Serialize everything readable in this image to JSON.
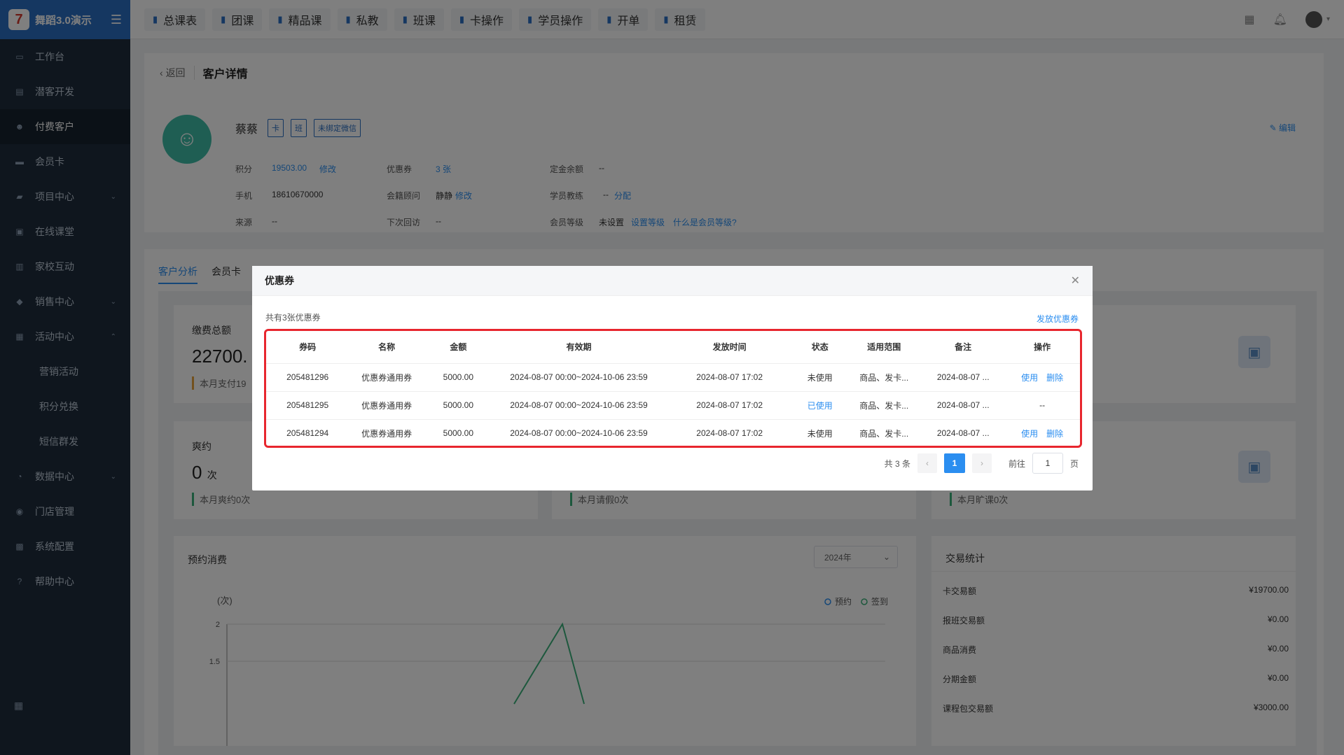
{
  "brand": {
    "title": "舞蹈3.0演示",
    "logo_glyph": "7"
  },
  "sidebar": {
    "items": [
      {
        "label": "工作台",
        "icon": "monitor-icon"
      },
      {
        "label": "潜客开发",
        "icon": "contacts-icon"
      },
      {
        "label": "付费客户",
        "icon": "users-icon",
        "active": true
      },
      {
        "label": "会员卡",
        "icon": "card-icon"
      },
      {
        "label": "项目中心",
        "icon": "folder-icon",
        "expandable": true
      },
      {
        "label": "在线课堂",
        "icon": "tv-icon"
      },
      {
        "label": "家校互动",
        "icon": "book-icon"
      },
      {
        "label": "销售中心",
        "icon": "tag-icon",
        "expandable": true
      },
      {
        "label": "活动中心",
        "icon": "gift-icon",
        "expanded": true
      }
    ],
    "sub_items": [
      "营销活动",
      "积分兑换",
      "短信群发"
    ],
    "items_after": [
      {
        "label": "数据中心",
        "icon": "chart-icon",
        "expandable": true
      },
      {
        "label": "门店管理",
        "icon": "store-icon"
      },
      {
        "label": "系统配置",
        "icon": "settings-icon"
      },
      {
        "label": "帮助中心",
        "icon": "help-icon"
      }
    ]
  },
  "topbar": {
    "tabs": [
      "总课表",
      "团课",
      "精品课",
      "私教",
      "班课",
      "卡操作",
      "学员操作",
      "开单",
      "租赁"
    ]
  },
  "page": {
    "back_label": "返回",
    "title": "客户详情",
    "edit_label": "编辑"
  },
  "profile": {
    "name": "蔡蔡",
    "tags": [
      "卡",
      "班",
      "未绑定微信"
    ],
    "points_label": "积分",
    "points": "19503.00",
    "modify": "修改",
    "coupon_label": "优惠券",
    "coupon_count": "3 张",
    "deposit_label": "定金余额",
    "deposit": "--",
    "phone_label": "手机",
    "phone": "18610670000",
    "advisor_label": "会籍顾问",
    "advisor": "静静",
    "advisor_modify": "修改",
    "coach_label": "学员教练",
    "coach": "--",
    "coach_assign": "分配",
    "source_label": "来源",
    "source": "--",
    "next_visit_label": "下次回访",
    "next_visit": "--",
    "level_label": "会员等级",
    "level": "未设置",
    "set_level": "设置等级",
    "what_level": "什么是会员等级?"
  },
  "tabs": {
    "active": "客户分析",
    "second": "会员卡"
  },
  "stats": {
    "total_title": "缴费总额",
    "total_value": "22700.",
    "total_sub": "本月支付19",
    "miss_title": "爽约",
    "miss_value": "0",
    "miss_unit": "次",
    "miss_sub": "本月爽约0次",
    "leave_sub": "本月请假0次",
    "absent_sub": "本月旷课0次"
  },
  "chart_section": {
    "title": "预约消费",
    "year_select": "2024年",
    "ylabel": "(次)",
    "legend": [
      "预约",
      "签到"
    ]
  },
  "chart_data": {
    "type": "line",
    "ylabel": "(次)",
    "yticks": [
      "2",
      "1.5"
    ],
    "series": [
      {
        "name": "预约",
        "values": []
      },
      {
        "name": "签到",
        "values": []
      }
    ]
  },
  "trade": {
    "title": "交易统计",
    "rows": [
      {
        "label": "卡交易额",
        "value": "¥19700.00"
      },
      {
        "label": "报班交易额",
        "value": "¥0.00"
      },
      {
        "label": "商品消费",
        "value": "¥0.00"
      },
      {
        "label": "分期金额",
        "value": "¥0.00"
      },
      {
        "label": "课程包交易额",
        "value": "¥3000.00"
      }
    ]
  },
  "dialog": {
    "title": "优惠券",
    "count_text": "共有3张优惠券",
    "issue_label": "发放优惠券",
    "columns": [
      "券码",
      "名称",
      "金额",
      "有效期",
      "发放时间",
      "状态",
      "适用范围",
      "备注",
      "操作"
    ],
    "rows": [
      {
        "code": "205481296",
        "name": "优惠券通用券",
        "amount": "5000.00",
        "validity": "2024-08-07 00:00~2024-10-06 23:59",
        "issued": "2024-08-07 17:02",
        "status": "未使用",
        "scope": "商品、发卡...",
        "note": "2024-08-07 ...",
        "actions": [
          "使用",
          "删除"
        ]
      },
      {
        "code": "205481295",
        "name": "优惠券通用券",
        "amount": "5000.00",
        "validity": "2024-08-07 00:00~2024-10-06 23:59",
        "issued": "2024-08-07 17:02",
        "status": "已使用",
        "scope": "商品、发卡...",
        "note": "2024-08-07 ...",
        "actions": [
          "--"
        ]
      },
      {
        "code": "205481294",
        "name": "优惠券通用券",
        "amount": "5000.00",
        "validity": "2024-08-07 00:00~2024-10-06 23:59",
        "issued": "2024-08-07 17:02",
        "status": "未使用",
        "scope": "商品、发卡...",
        "note": "2024-08-07 ...",
        "actions": [
          "使用",
          "删除"
        ]
      }
    ],
    "pager": {
      "total": "共 3 条",
      "current": "1",
      "goto_label": "前往",
      "goto_value": "1",
      "page_unit": "页"
    }
  }
}
